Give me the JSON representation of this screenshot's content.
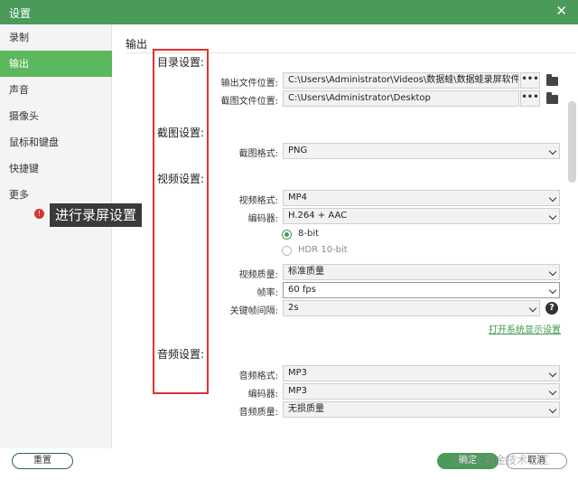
{
  "window": {
    "title": "设置",
    "close_glyph": "✕"
  },
  "sidebar": {
    "items": [
      {
        "label": "录制"
      },
      {
        "label": "输出",
        "active": true
      },
      {
        "label": "声音"
      },
      {
        "label": "摄像头"
      },
      {
        "label": "鼠标和键盘"
      },
      {
        "label": "快捷键"
      },
      {
        "label": "更多"
      }
    ]
  },
  "annotation": {
    "badge": "!",
    "text": "进行录屏设置"
  },
  "page": {
    "title": "输出"
  },
  "sections": {
    "directory": "目录设置:",
    "screenshot": "截图设置:",
    "video": "视频设置:",
    "audio": "音频设置:"
  },
  "directory": {
    "output_label": "输出文件位置:",
    "output_path": "C:\\Users\\Administrator\\Videos\\数据蛙\\数据蛙录屏软件",
    "screenshot_label": "截图文件位置:",
    "screenshot_path": "C:\\Users\\Administrator\\Desktop",
    "browse": "•••"
  },
  "screenshot": {
    "format_label": "截图格式:",
    "format": "PNG"
  },
  "video": {
    "format_label": "视频格式:",
    "format": "MP4",
    "encoder_label": "编码器:",
    "encoder": "H.264 + AAC",
    "bit_8": "8-bit",
    "bit_8_selected": true,
    "hdr": "HDR 10-bit",
    "quality_label": "视频质量:",
    "quality": "标准质量",
    "fps_label": "帧率:",
    "fps": "60 fps",
    "keyframe_label": "关键帧间隔:",
    "keyframe": "2s",
    "help": "?",
    "system_link": "打开系统显示设置"
  },
  "audio": {
    "format_label": "音频格式:",
    "format": "MP3",
    "encoder_label": "编码器:",
    "encoder": "MP3",
    "quality_label": "音频质量:",
    "quality": "无损质量"
  },
  "footer": {
    "reset": "重置",
    "ok": "确定",
    "cancel": "取消"
  },
  "watermark": "@稀土掘金技术社区",
  "colors": {
    "accent": "#4a9a5a",
    "highlight_box": "#e03131",
    "link": "#3a9a4a"
  }
}
